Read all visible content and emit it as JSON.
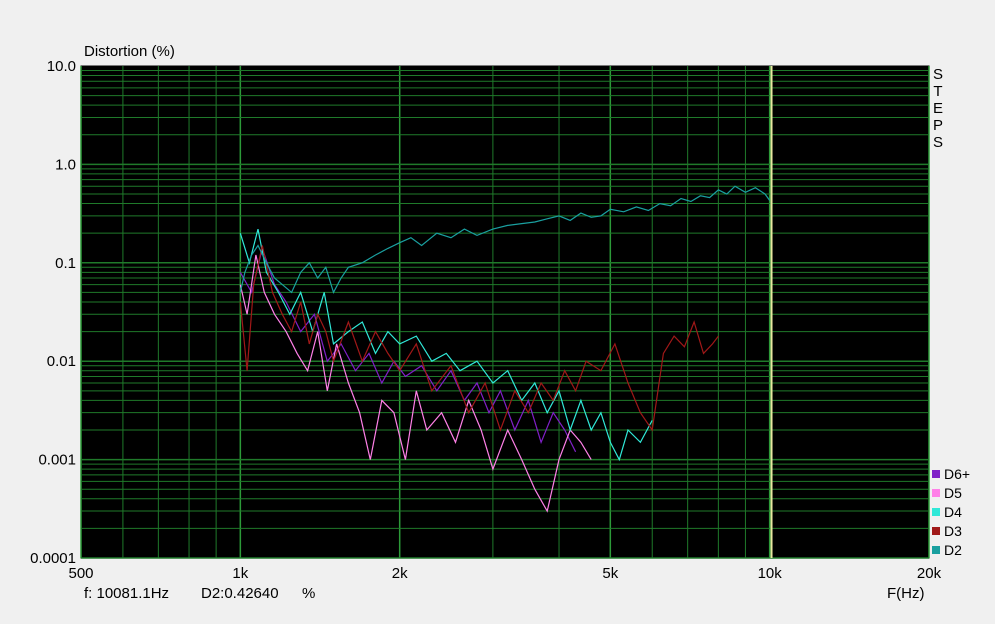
{
  "window": {
    "side_button": "STEPS"
  },
  "readout": {
    "freq": "f: 10081.1Hz",
    "value": "D2:0.42640",
    "unit": "%"
  },
  "chart_data": {
    "type": "line",
    "ylabel": "Distortion (%)",
    "xlabel": "F(Hz)",
    "x_scale": "log",
    "y_scale": "log",
    "xlim": [
      500,
      20000
    ],
    "ylim": [
      0.0001,
      10
    ],
    "x_ticks": [
      {
        "v": 500,
        "t": "500"
      },
      {
        "v": 1000,
        "t": "1k"
      },
      {
        "v": 2000,
        "t": "2k"
      },
      {
        "v": 5000,
        "t": "5k"
      },
      {
        "v": 10000,
        "t": "10k"
      },
      {
        "v": 20000,
        "t": "20k"
      }
    ],
    "y_ticks": [
      {
        "v": 10,
        "t": "10.0"
      },
      {
        "v": 1,
        "t": "1.0"
      },
      {
        "v": 0.1,
        "t": "0.1"
      },
      {
        "v": 0.01,
        "t": "0.01"
      },
      {
        "v": 0.001,
        "t": "0.001"
      },
      {
        "v": 0.0001,
        "t": "0.0001"
      }
    ],
    "grid": true,
    "cursor_x": 10081.1,
    "background": "#000000",
    "grid_color": "#1f7a2a",
    "legend_position": "bottom-right",
    "series": [
      {
        "name": "D2",
        "color": "#1aa0a0",
        "x": [
          1000,
          1020,
          1050,
          1080,
          1120,
          1160,
          1200,
          1250,
          1300,
          1350,
          1400,
          1450,
          1500,
          1550,
          1600,
          1700,
          1800,
          1900,
          2000,
          2100,
          2200,
          2350,
          2500,
          2650,
          2800,
          3000,
          3200,
          3400,
          3600,
          3800,
          4000,
          4200,
          4400,
          4600,
          4800,
          5000,
          5300,
          5600,
          5900,
          6200,
          6500,
          6800,
          7100,
          7400,
          7700,
          8000,
          8300,
          8600,
          9000,
          9400,
          9800,
          10000
        ],
        "y": [
          0.05,
          0.08,
          0.12,
          0.15,
          0.1,
          0.07,
          0.06,
          0.05,
          0.08,
          0.1,
          0.07,
          0.09,
          0.05,
          0.07,
          0.09,
          0.1,
          0.12,
          0.14,
          0.16,
          0.18,
          0.15,
          0.2,
          0.18,
          0.22,
          0.19,
          0.22,
          0.24,
          0.25,
          0.26,
          0.28,
          0.3,
          0.27,
          0.32,
          0.29,
          0.3,
          0.35,
          0.33,
          0.37,
          0.34,
          0.4,
          0.38,
          0.45,
          0.42,
          0.48,
          0.46,
          0.55,
          0.5,
          0.6,
          0.52,
          0.58,
          0.5,
          0.43
        ]
      },
      {
        "name": "D3",
        "color": "#a01818",
        "x": [
          1000,
          1030,
          1060,
          1100,
          1150,
          1200,
          1250,
          1300,
          1350,
          1400,
          1450,
          1500,
          1600,
          1700,
          1800,
          1900,
          2000,
          2150,
          2300,
          2500,
          2700,
          2900,
          3100,
          3300,
          3500,
          3700,
          3900,
          4100,
          4300,
          4500,
          4800,
          5100,
          5400,
          5700,
          6000,
          6300,
          6600,
          6900,
          7200,
          7500,
          7800,
          8000
        ],
        "y": [
          0.04,
          0.008,
          0.06,
          0.15,
          0.05,
          0.03,
          0.02,
          0.04,
          0.015,
          0.03,
          0.02,
          0.01,
          0.025,
          0.01,
          0.02,
          0.012,
          0.008,
          0.015,
          0.005,
          0.009,
          0.003,
          0.006,
          0.002,
          0.005,
          0.003,
          0.006,
          0.004,
          0.008,
          0.005,
          0.01,
          0.008,
          0.015,
          0.006,
          0.003,
          0.002,
          0.012,
          0.018,
          0.014,
          0.025,
          0.012,
          0.015,
          0.018
        ]
      },
      {
        "name": "D4",
        "color": "#30e8d8",
        "x": [
          1000,
          1040,
          1080,
          1120,
          1180,
          1240,
          1300,
          1370,
          1440,
          1500,
          1600,
          1700,
          1800,
          1900,
          2000,
          2150,
          2300,
          2450,
          2600,
          2800,
          3000,
          3200,
          3400,
          3600,
          3800,
          4000,
          4200,
          4400,
          4600,
          4800,
          5000,
          5200,
          5400,
          5700,
          6000
        ],
        "y": [
          0.2,
          0.1,
          0.22,
          0.08,
          0.05,
          0.03,
          0.05,
          0.02,
          0.05,
          0.015,
          0.02,
          0.025,
          0.012,
          0.02,
          0.015,
          0.018,
          0.01,
          0.012,
          0.008,
          0.01,
          0.006,
          0.008,
          0.004,
          0.006,
          0.003,
          0.005,
          0.002,
          0.004,
          0.002,
          0.003,
          0.0015,
          0.001,
          0.002,
          0.0015,
          0.0025
        ]
      },
      {
        "name": "D5",
        "color": "#ff80e8",
        "x": [
          1000,
          1030,
          1070,
          1110,
          1160,
          1220,
          1280,
          1340,
          1400,
          1460,
          1520,
          1600,
          1680,
          1760,
          1850,
          1950,
          2050,
          2150,
          2250,
          2400,
          2550,
          2700,
          2850,
          3000,
          3200,
          3400,
          3600,
          3800,
          4000,
          4200,
          4400,
          4600
        ],
        "y": [
          0.06,
          0.03,
          0.12,
          0.05,
          0.03,
          0.02,
          0.012,
          0.008,
          0.02,
          0.005,
          0.015,
          0.006,
          0.003,
          0.001,
          0.004,
          0.003,
          0.001,
          0.005,
          0.002,
          0.003,
          0.0015,
          0.004,
          0.002,
          0.0008,
          0.002,
          0.001,
          0.0005,
          0.0003,
          0.001,
          0.002,
          0.0015,
          0.001
        ]
      },
      {
        "name": "D6+",
        "color": "#8020c8",
        "x": [
          1000,
          1050,
          1100,
          1160,
          1220,
          1300,
          1380,
          1460,
          1550,
          1650,
          1750,
          1850,
          1950,
          2050,
          2200,
          2350,
          2500,
          2650,
          2800,
          2950,
          3100,
          3300,
          3500,
          3700,
          3900,
          4100,
          4300
        ],
        "y": [
          0.08,
          0.05,
          0.14,
          0.06,
          0.04,
          0.02,
          0.03,
          0.01,
          0.015,
          0.008,
          0.012,
          0.006,
          0.01,
          0.007,
          0.009,
          0.005,
          0.008,
          0.004,
          0.006,
          0.003,
          0.005,
          0.002,
          0.004,
          0.0015,
          0.003,
          0.002,
          0.0012
        ]
      }
    ]
  }
}
